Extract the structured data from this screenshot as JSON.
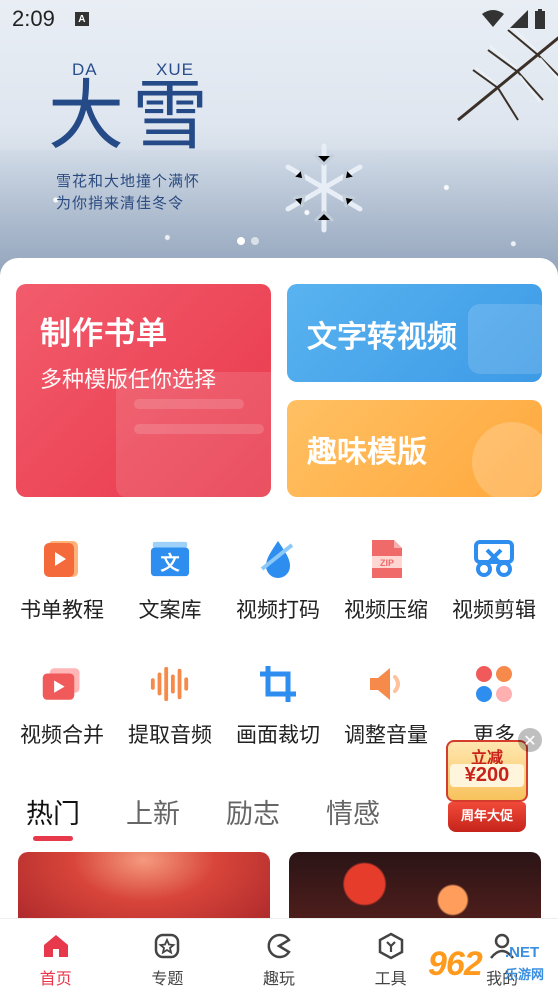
{
  "status_bar": {
    "time": "2:09",
    "notif_letter": "A"
  },
  "banner": {
    "pinyin_da": "DA",
    "pinyin_xue": "XUE",
    "title": "大雪",
    "poem_line1": "雪花和大地撞个满怀",
    "poem_line2": "为你捎来清佳冬令"
  },
  "feature_cards": {
    "make_booklist": {
      "title": "制作书单",
      "subtitle": "多种模版任你选择"
    },
    "text_to_video": {
      "title": "文字转视频"
    },
    "fun_templates": {
      "title": "趣味模版"
    }
  },
  "tools_row1": [
    {
      "label": "书单教程",
      "icon": "tutorial-icon"
    },
    {
      "label": "文案库",
      "icon": "text-library-icon"
    },
    {
      "label": "视频打码",
      "icon": "mosaic-icon"
    },
    {
      "label": "视频压缩",
      "icon": "zip-icon"
    },
    {
      "label": "视频剪辑",
      "icon": "scissors-icon"
    }
  ],
  "tools_row2": [
    {
      "label": "视频合并",
      "icon": "merge-icon"
    },
    {
      "label": "提取音频",
      "icon": "audio-wave-icon"
    },
    {
      "label": "画面裁切",
      "icon": "crop-icon"
    },
    {
      "label": "调整音量",
      "icon": "volume-icon"
    },
    {
      "label": "更多",
      "icon": "more-icon"
    }
  ],
  "tabs": [
    "热门",
    "上新",
    "励志",
    "情感"
  ],
  "promo": {
    "label": "立减",
    "amount": "¥200",
    "footer": "周年大促"
  },
  "bottom_nav": [
    {
      "label": "首页",
      "icon": "home-icon"
    },
    {
      "label": "专题",
      "icon": "topic-icon"
    },
    {
      "label": "趣玩",
      "icon": "fun-icon"
    },
    {
      "label": "工具",
      "icon": "tools-icon"
    },
    {
      "label": "我的",
      "icon": "profile-icon"
    }
  ],
  "watermark": {
    "number": "962",
    "domain": ".NET",
    "name": "乐游网"
  },
  "colors": {
    "accent": "#e8384b",
    "blue_card": "#3d9ae6",
    "orange_card": "#ffa83c",
    "title_blue": "#244a88"
  }
}
